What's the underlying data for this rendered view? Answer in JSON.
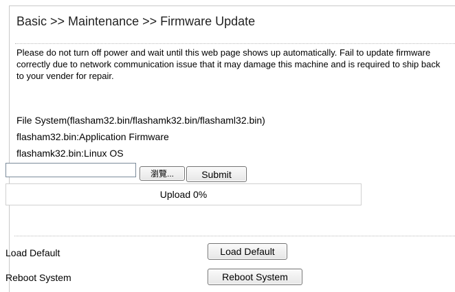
{
  "header": {
    "title": "Basic >> Maintenance >> Firmware Update"
  },
  "notice": {
    "text": "Please do not turn off power and wait until this web page shows up automatically.  Fail to update firmware correctly due to network communication issue that it may damage this machine and is required to ship back to your vender for repair."
  },
  "info": {
    "file_system": "File System(flasham32.bin/flashamk32.bin/flashaml32.bin)",
    "app_firmware": "flasham32.bin:Application Firmware",
    "linux_os": "flashamk32.bin:Linux OS"
  },
  "upload": {
    "file_value": "",
    "browse_label": "瀏覽...",
    "submit_label": "Submit",
    "progress_text": "Upload 0%",
    "progress_fraction": 0
  },
  "actions": {
    "load_default_label": "Load Default",
    "load_default_button": "Load Default",
    "reboot_label": "Reboot System",
    "reboot_button": "Reboot System"
  },
  "colors": {
    "border": "#c8c8c8",
    "separator": "#b9b9b9",
    "progress_fill": "#2b6fc2"
  }
}
